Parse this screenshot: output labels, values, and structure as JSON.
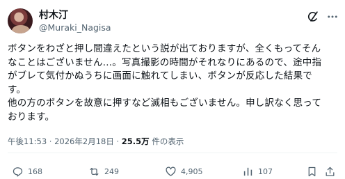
{
  "author": {
    "name": "村木汀",
    "handle": "@Muraki_Nagisa"
  },
  "post": {
    "text": "ボタンをわざと押し間違えたという説が出ておりますが、全くもってそん\nなことはございません…。写真撮影の時間がそれなりにあるので、途中指\nがブレて気付かぬうちに画面に触れてしまい、ボタンが反応した結果で\nす。\n他の方のボタンを故意に押すなど滅相もございません。申し訳なく思って\nおります。",
    "timestamp": "午後11:53 · 2026年2月18日 ·",
    "views_count": "25.5万",
    "views_label": "件の表示"
  },
  "actions": {
    "replies": "168",
    "reposts": "249",
    "likes": "4,905",
    "views": "107"
  },
  "icons": [
    "grok-icon",
    "more-options-icon",
    "reply-icon",
    "repost-icon",
    "like-icon",
    "views-icon",
    "bookmark-icon",
    "share-icon"
  ],
  "colors": {
    "text": "#0f1419",
    "secondary_text": "#536471",
    "divider": "#eff3f4"
  }
}
